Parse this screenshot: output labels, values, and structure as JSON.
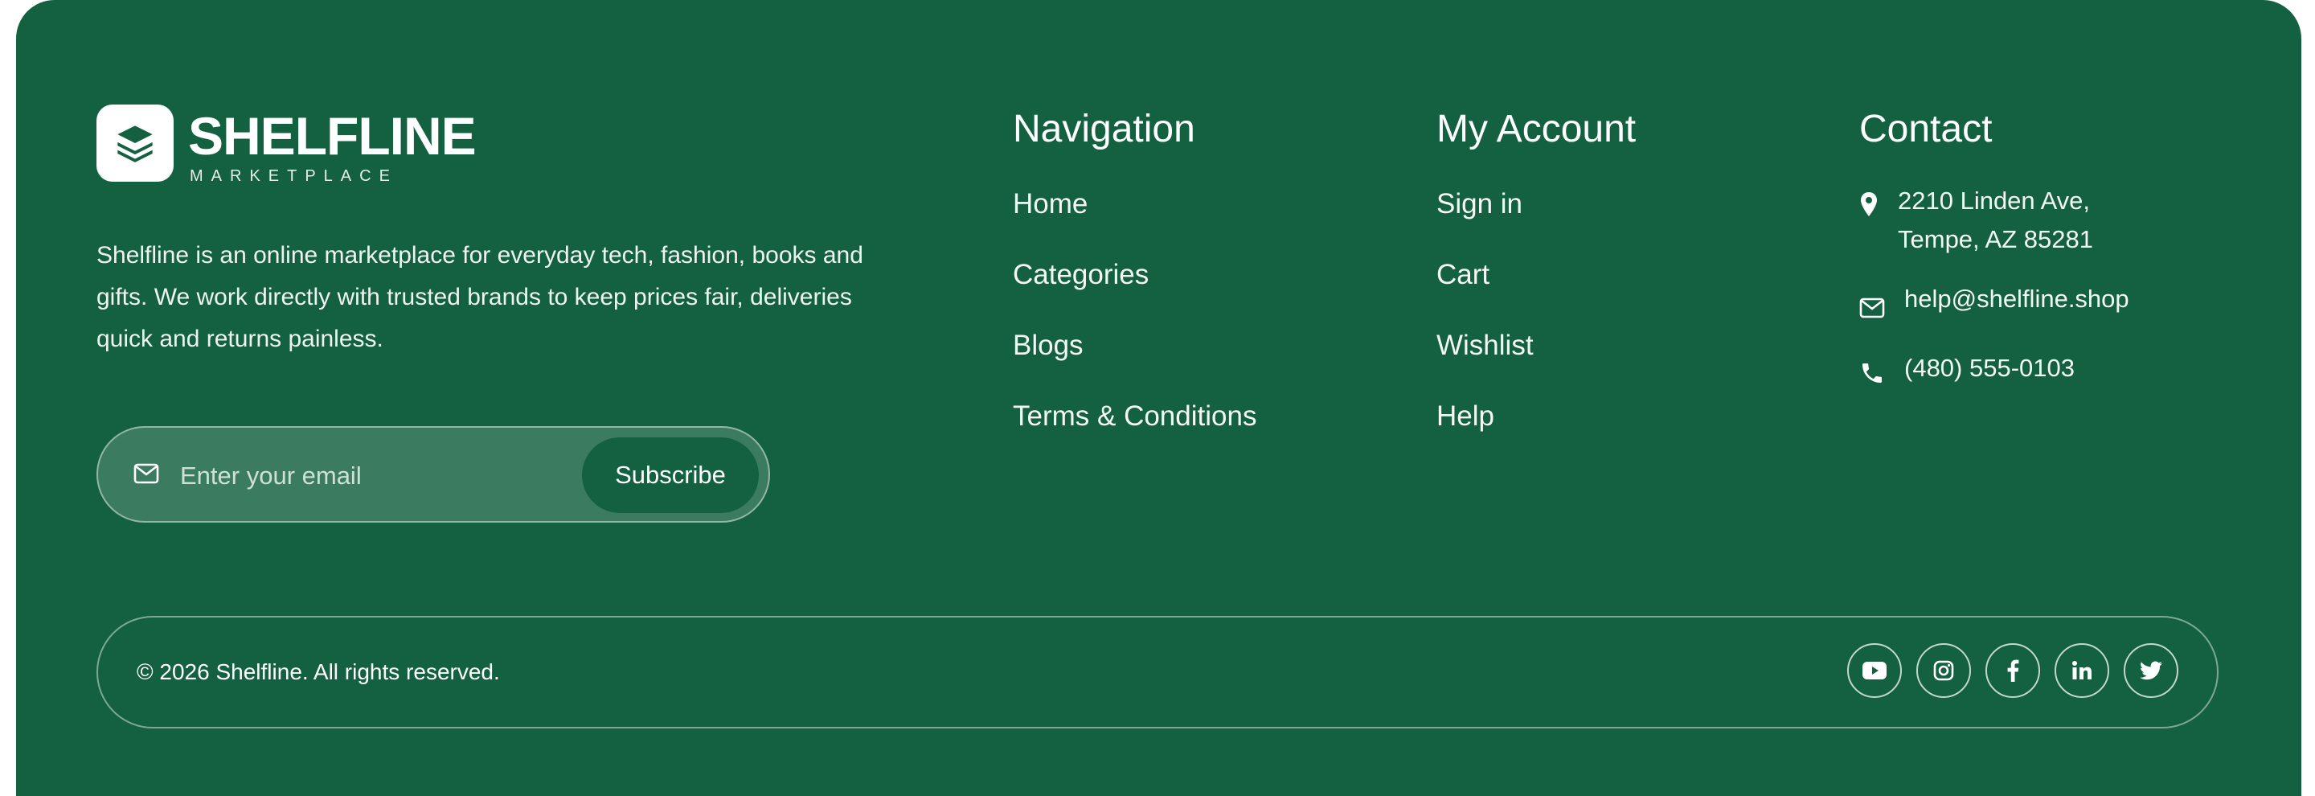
{
  "brand": {
    "name": "SHELFLINE",
    "tagline": "MARKETPLACE",
    "logo_icon": "layers-icon"
  },
  "description": "Shelfline is an online marketplace for everyday tech, fashion, books and gifts. We work directly with trusted brands to keep prices fair, deliveries quick and returns painless.",
  "subscribe": {
    "placeholder": "Enter your email",
    "value": "",
    "icon": "mail-icon",
    "button_label": "Subscribe"
  },
  "navigation": {
    "title": "Navigation",
    "items": [
      "Home",
      "Categories",
      "Blogs",
      "Terms & Conditions"
    ]
  },
  "account": {
    "title": "My Account",
    "items": [
      "Sign in",
      "Cart",
      "Wishlist",
      "Help"
    ]
  },
  "contact": {
    "title": "Contact",
    "address_line1": "2210 Linden Ave,",
    "address_line2": "Tempe, AZ 85281",
    "email": "help@shelfline.shop",
    "phone": "(480) 555-0103"
  },
  "footer": {
    "copyright": "© 2026 Shelfline. All rights reserved.",
    "socials": [
      "youtube-icon",
      "instagram-icon",
      "facebook-icon",
      "linkedin-icon",
      "twitter-icon"
    ]
  },
  "colors": {
    "background": "#136140",
    "text": "#ffffff",
    "input_bg": "#3b7c60"
  }
}
